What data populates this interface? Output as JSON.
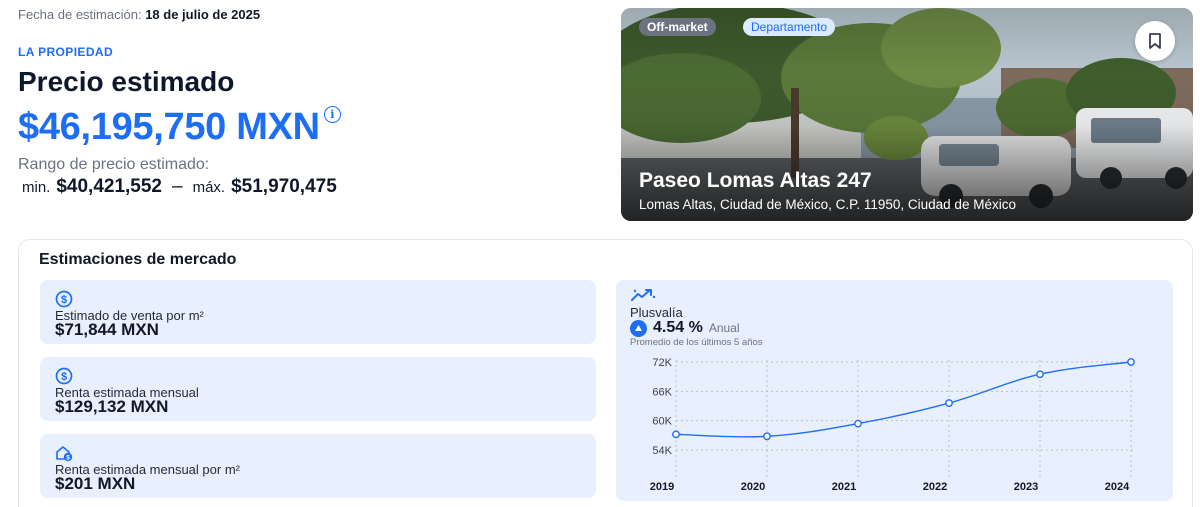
{
  "estimate": {
    "date_label": "Fecha de estimación:",
    "date_value": "18 de julio de 2025",
    "section_label": "LA PROPIEDAD",
    "headline": "Precio estimado",
    "price": "$46,195,750 MXN",
    "info_icon": "info-icon",
    "range_label": "Rango de precio estimado:",
    "min_prefix": "min.",
    "min_value": "$40,421,552",
    "separator": "–",
    "max_prefix": "máx.",
    "max_value": "$51,970,475"
  },
  "property": {
    "badge_status": "Off-market",
    "badge_type": "Departamento",
    "bookmark_icon": "bookmark-icon",
    "title": "Paseo Lomas Altas 247",
    "address": "Lomas Altas, Ciudad de México, C.P. 11950, Ciudad de México"
  },
  "market": {
    "title": "Estimaciones de mercado",
    "metrics": [
      {
        "icon": "dollar-circle-icon",
        "label": "Estimado de venta por m²",
        "value": "$71,844 MXN"
      },
      {
        "icon": "dollar-circle-icon",
        "label": "Renta estimada mensual",
        "value": "$129,132 MXN"
      },
      {
        "icon": "house-dollar-icon",
        "label": "Renta estimada mensual por m²",
        "value": "$201 MXN"
      }
    ],
    "plusvalia": {
      "icon": "trend-up-icon",
      "label": "Plusvalía",
      "trend_icon": "arrow-up-icon",
      "value": "4.54 %",
      "period": "Anual",
      "note": "Promedio de los últimos 5 años"
    }
  },
  "colors": {
    "accent": "#1d6df5",
    "panel": "#e8f0fd"
  },
  "chart_data": {
    "type": "line",
    "categories": [
      "2019",
      "2020",
      "2021",
      "2022",
      "2023",
      "2024"
    ],
    "series": [
      {
        "values": [
          57200,
          56800,
          59400,
          63600,
          69500,
          72000
        ]
      }
    ],
    "y_ticks": [
      "54K",
      "60K",
      "66K",
      "72K"
    ],
    "y_tick_values": [
      54000,
      60000,
      66000,
      72000
    ],
    "ylim": [
      54000,
      72000
    ],
    "grid": true,
    "title": "",
    "xlabel": "",
    "ylabel": ""
  }
}
